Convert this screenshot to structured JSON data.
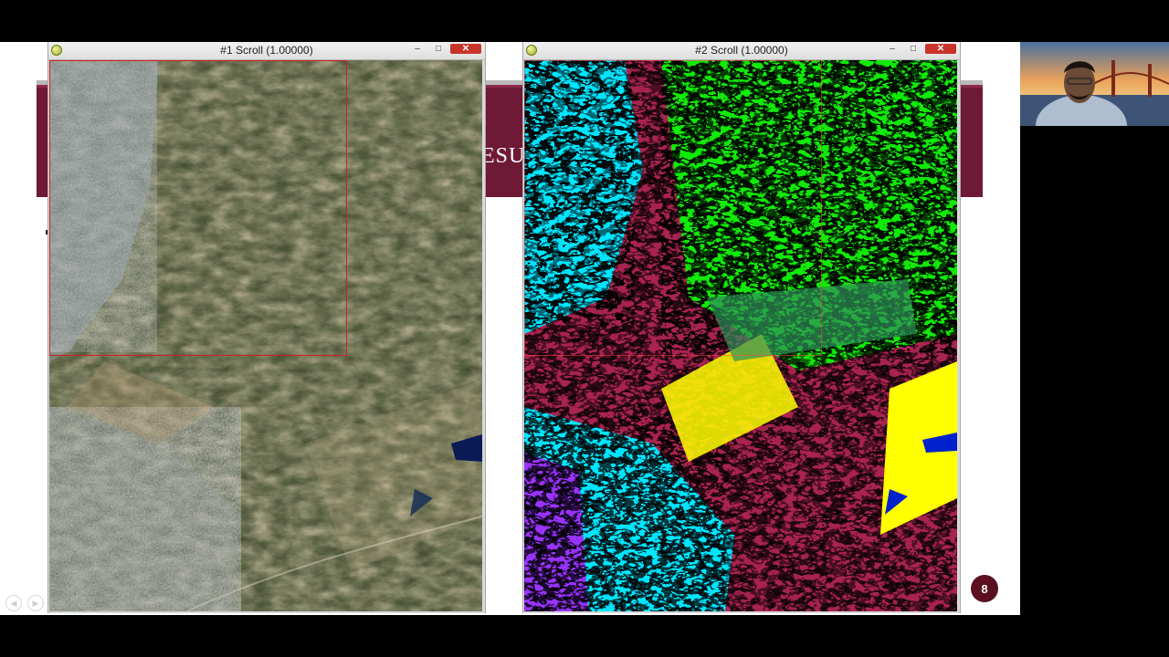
{
  "slide": {
    "title_fragment": "ESU",
    "page_number": "8",
    "colors": {
      "maroon": "#6e1a37",
      "band_gray": "#b9b9b9",
      "badge": "#5a1020"
    }
  },
  "windows": [
    {
      "title": "#1 Scroll (1.00000)",
      "minimize": "–",
      "maximize": "□",
      "close": "✕",
      "view": "true-color-satellite-image"
    },
    {
      "title": "#2 Scroll (1.00000)",
      "minimize": "–",
      "maximize": "□",
      "close": "✕",
      "view": "land-cover-classification-image"
    }
  ],
  "classification_palette": {
    "class_a": "#00ff00",
    "class_b": "#a8234f",
    "class_c": "#00e5ff",
    "class_d": "#ffff00",
    "class_e": "#9933ff",
    "class_f": "#0022cc",
    "class_g": "#2f8f5a"
  },
  "nav_icons": [
    "prev-slide-icon",
    "next-slide-icon"
  ],
  "webcam": {
    "label": "presenter-video"
  }
}
